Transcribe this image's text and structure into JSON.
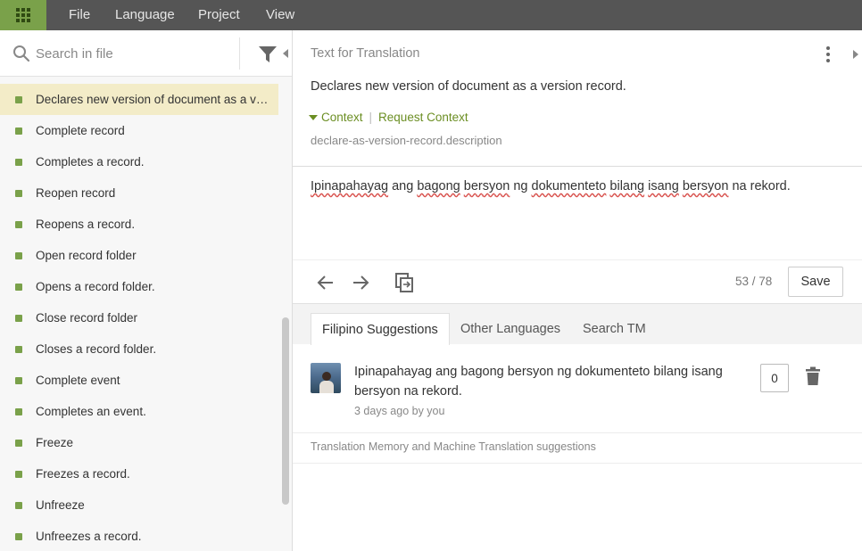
{
  "menu": {
    "items": [
      {
        "label": "File"
      },
      {
        "label": "Language"
      },
      {
        "label": "Project"
      },
      {
        "label": "View"
      }
    ]
  },
  "search": {
    "placeholder": "Search in file"
  },
  "list": {
    "items": [
      {
        "label": "Declares new version of document as a version record.",
        "active": true
      },
      {
        "label": "Complete record"
      },
      {
        "label": "Completes a record."
      },
      {
        "label": "Reopen record"
      },
      {
        "label": "Reopens a record."
      },
      {
        "label": "Open record folder"
      },
      {
        "label": "Opens a record folder."
      },
      {
        "label": "Close record folder"
      },
      {
        "label": "Closes a record folder."
      },
      {
        "label": "Complete event"
      },
      {
        "label": "Completes an event."
      },
      {
        "label": "Freeze"
      },
      {
        "label": "Freezes a record."
      },
      {
        "label": "Unfreeze"
      },
      {
        "label": "Unfreezes a record."
      }
    ]
  },
  "source": {
    "header": "Text for Translation",
    "text": "Declares new version of document as a version record.",
    "context_label": "Context",
    "separator": "|",
    "request_context": "Request Context",
    "key": "declare-as-version-record.description"
  },
  "translation": {
    "w1": "Ipinapahayag",
    "w2": " ang ",
    "w3": "bagong",
    "w4": " ",
    "w5": "bersyon",
    "w6": " ng ",
    "w7": "dokumenteto",
    "w8": " ",
    "w9": "bilang",
    "w10": " ",
    "w11": "isang",
    "w12": " ",
    "w13": "bersyon",
    "w14": " na rekord."
  },
  "toolbar": {
    "counter": "53 / 78",
    "save_label": "Save"
  },
  "tabs": [
    {
      "label": "Filipino Suggestions"
    },
    {
      "label": "Other Languages"
    },
    {
      "label": "Search TM"
    }
  ],
  "suggestion": {
    "text": "Ipinapahayag ang bagong bersyon ng dokumenteto bilang isang bersyon na rekord.",
    "meta": "3 days ago by you",
    "votes": "0"
  },
  "tm_note": "Translation Memory and Machine Translation suggestions",
  "colors": {
    "accent": "#7aa14a",
    "topbar": "#555555",
    "active_row": "#f3ecc8"
  }
}
